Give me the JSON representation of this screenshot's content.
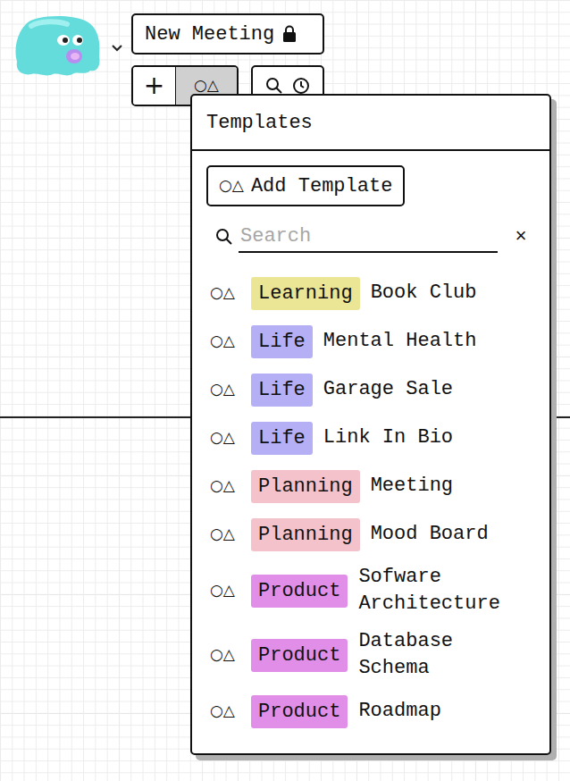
{
  "meeting": {
    "title": "New Meeting"
  },
  "toolbar": [
    {
      "label": "+",
      "selected": false
    },
    {
      "label": "○△",
      "selected": true
    }
  ],
  "templates": {
    "title": "Templates",
    "add_button": {
      "icon": "○△",
      "label": "Add Template"
    },
    "search": {
      "placeholder": "Search",
      "clear": "×"
    },
    "items": [
      {
        "icon": "○△",
        "tag": "Learning",
        "color": "#ebe596",
        "name": "Book Club"
      },
      {
        "icon": "○△",
        "tag": "Life",
        "color": "#b5aff6",
        "name": "Mental Health"
      },
      {
        "icon": "○△",
        "tag": "Life",
        "color": "#b5aff6",
        "name": "Garage Sale"
      },
      {
        "icon": "○△",
        "tag": "Life",
        "color": "#b5aff6",
        "name": "Link In Bio"
      },
      {
        "icon": "○△",
        "tag": "Planning",
        "color": "#f4c2ca",
        "name": "Meeting"
      },
      {
        "icon": "○△",
        "tag": "Planning",
        "color": "#f4c2ca",
        "name": "Mood Board"
      },
      {
        "icon": "○△",
        "tag": "Product",
        "color": "#e08ee7",
        "name": "Sofware Architecture"
      },
      {
        "icon": "○△",
        "tag": "Product",
        "color": "#e08ee7",
        "name": "Database Schema"
      },
      {
        "icon": "○△",
        "tag": "Product",
        "color": "#e08ee7",
        "name": "Roadmap"
      }
    ]
  }
}
